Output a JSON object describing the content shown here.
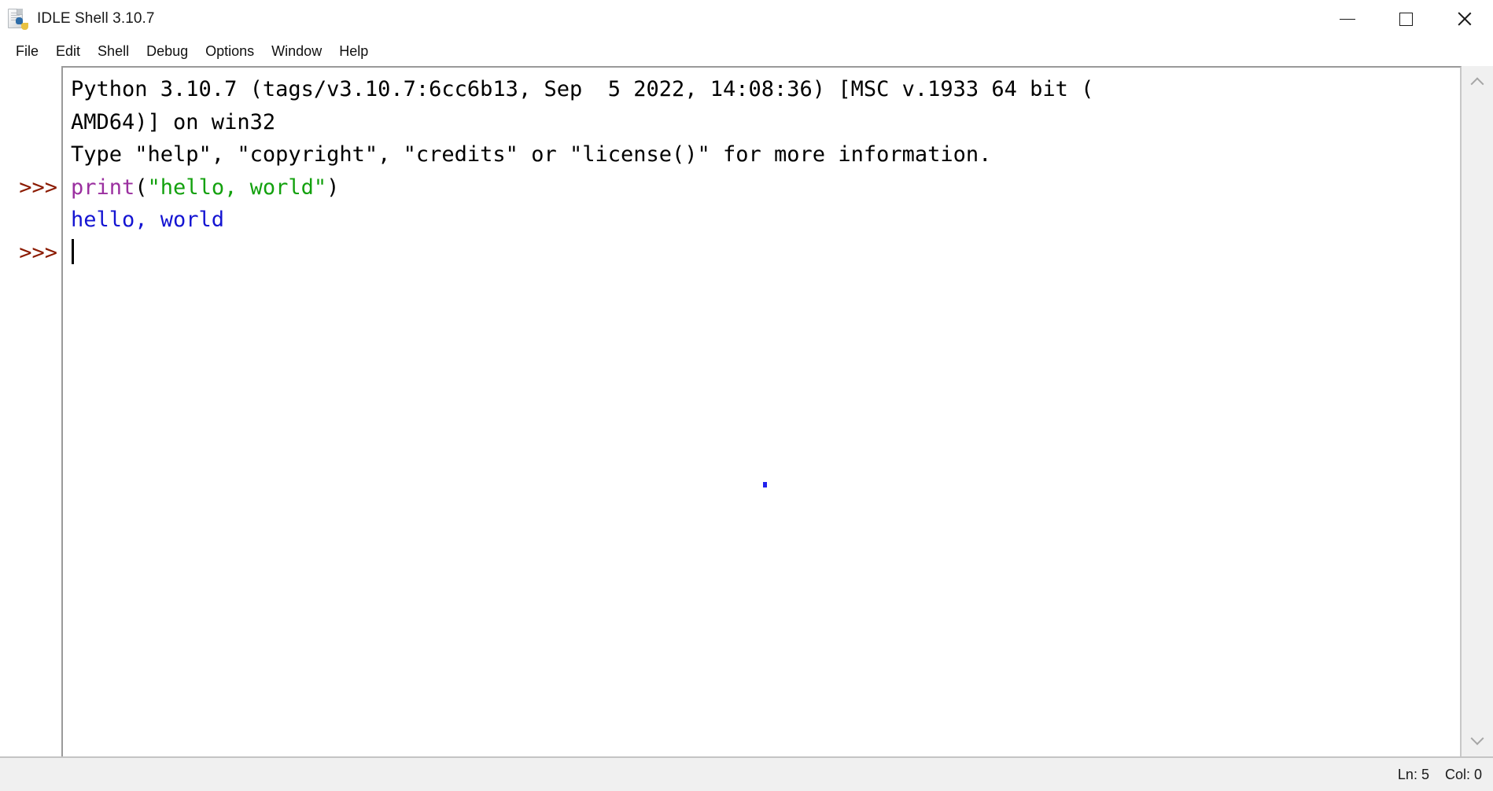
{
  "window": {
    "title": "IDLE Shell 3.10.7",
    "icon": "python-document-icon",
    "controls": {
      "minimize": "minimize-icon",
      "maximize": "maximize-icon",
      "close": "close-icon"
    }
  },
  "menubar": {
    "items": [
      {
        "label": "File"
      },
      {
        "label": "Edit"
      },
      {
        "label": "Shell"
      },
      {
        "label": "Debug"
      },
      {
        "label": "Options"
      },
      {
        "label": "Window"
      },
      {
        "label": "Help"
      }
    ]
  },
  "shell": {
    "prompts": [
      "",
      "",
      "",
      ">>>",
      "",
      ">>>"
    ],
    "lines": [
      {
        "kind": "banner",
        "segments": [
          {
            "text": "Python 3.10.7 (tags/v3.10.7:6cc6b13, Sep  5 2022, 14:08:36) [MSC v.1933 64 bit (",
            "style": "plain"
          }
        ]
      },
      {
        "kind": "banner",
        "segments": [
          {
            "text": "AMD64)] on win32",
            "style": "plain"
          }
        ]
      },
      {
        "kind": "banner",
        "segments": [
          {
            "text": "Type \"help\", \"copyright\", \"credits\" or \"license()\" for more information.",
            "style": "plain"
          }
        ]
      },
      {
        "kind": "input",
        "segments": [
          {
            "text": "print",
            "style": "builtin"
          },
          {
            "text": "(",
            "style": "plain"
          },
          {
            "text": "\"hello, world\"",
            "style": "string"
          },
          {
            "text": ")",
            "style": "plain"
          }
        ]
      },
      {
        "kind": "output",
        "segments": [
          {
            "text": "hello, world",
            "style": "stdout"
          }
        ]
      },
      {
        "kind": "input",
        "segments": []
      }
    ]
  },
  "scrollbar": {
    "up_icon": "chevron-up-icon",
    "down_icon": "chevron-down-icon"
  },
  "statusbar": {
    "line": "Ln: 5",
    "col": "Col: 0"
  },
  "colors": {
    "prompt": "#8b1a00",
    "builtin": "#9b30a0",
    "string": "#13a10e",
    "stdout": "#1414d2",
    "statusbar_bg": "#f0f0f0",
    "window_bg": "#ffffff"
  }
}
